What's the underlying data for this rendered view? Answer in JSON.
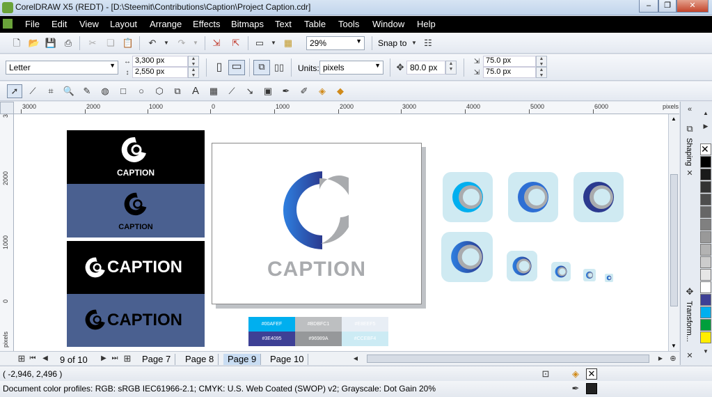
{
  "window": {
    "title": "CorelDRAW X5 (REDT) - [D:\\Steemit\\Contributions\\Caption\\Project Caption.cdr]",
    "minimize": "–",
    "restore": "❐",
    "close": "✕"
  },
  "menu": [
    "File",
    "Edit",
    "View",
    "Layout",
    "Arrange",
    "Effects",
    "Bitmaps",
    "Text",
    "Table",
    "Tools",
    "Window",
    "Help"
  ],
  "toolbar": {
    "zoom_value": "29%",
    "snap_label": "Snap to"
  },
  "property_bar": {
    "paper_size": "Letter",
    "width": "3,300 px",
    "height": "2,550 px",
    "units_label": "Units:",
    "units_value": "pixels",
    "nudge": "80.0 px",
    "dup_x": "75.0 px",
    "dup_y": "75.0 px"
  },
  "ruler": {
    "h_labels": [
      "3000",
      "2000",
      "1000",
      "0",
      "1000",
      "2000",
      "3000",
      "4000",
      "5000",
      "6000"
    ],
    "h_unit": "pixels",
    "v_labels": [
      "3",
      "2000",
      "1000",
      "0"
    ],
    "v_unit": "pixels"
  },
  "pages": {
    "counter": "9 of 10",
    "tabs": [
      "Page 7",
      "Page 8",
      "Page 9",
      "Page 10"
    ],
    "active": "Page 9"
  },
  "docker_tabs": [
    "Shaping",
    "Transform..."
  ],
  "artwork": {
    "brand": "CAPTION",
    "palette": [
      {
        "hex": "#00AFEF",
        "label": "#00AFEF"
      },
      {
        "hex": "#BDBFC1",
        "label": "#BDBFC1"
      },
      {
        "hex": "#E8EEF5",
        "label": "#E8EEF5"
      },
      {
        "hex": "#3E4095",
        "label": "#3E4095"
      },
      {
        "hex": "#96989A",
        "label": "#96989A"
      },
      {
        "hex": "#CCEBF4",
        "label": "#CCEBF4"
      }
    ]
  },
  "colors": {
    "accent_blue": "#2e6fd4",
    "dark_blue": "#2b3a8f",
    "gray": "#a9abae",
    "slate": "#4a6090",
    "icon_bg": "#cfeaf2"
  },
  "status": {
    "cursor": "( -2,946, 2,496 )",
    "profiles": "Document color profiles: RGB: sRGB IEC61966-2.1; CMYK: U.S. Web Coated (SWOP) v2; Grayscale: Dot Gain 20%"
  }
}
